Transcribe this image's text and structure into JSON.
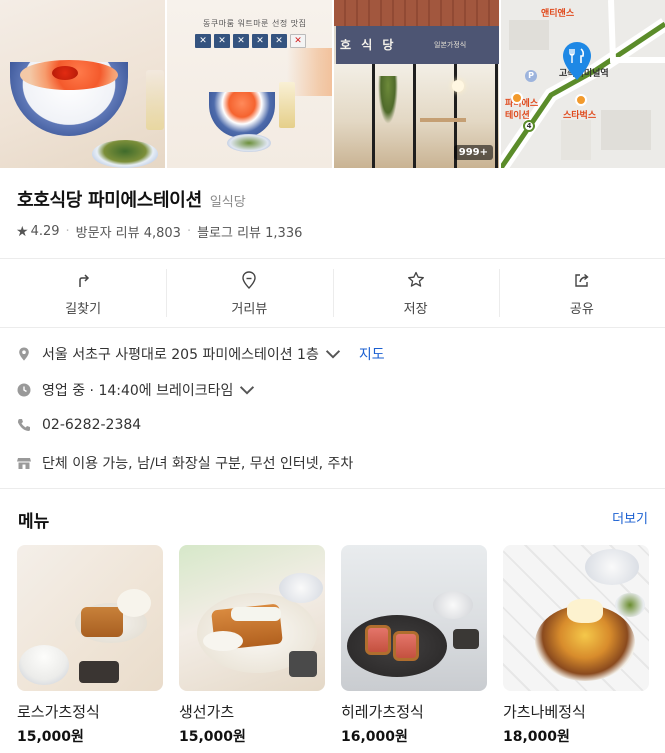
{
  "photos": {
    "poster_title": "동쿠마룸 워트마룬 선정 맛집",
    "poster_badges": [
      "✕",
      "✕",
      "✕",
      "✕",
      "✕",
      "✕"
    ],
    "store_sign": "호 식 당",
    "store_sign_sub": "일본가정식",
    "photo_count": "999+",
    "map_labels": {
      "entis": "앤티앤스",
      "terminal": "고속터미널역",
      "starbucks": "스타벅스",
      "famille": "파미에스테이션",
      "parking": "P",
      "metro": "4"
    }
  },
  "place": {
    "name": "호호식당 파미에스테이션",
    "category": "일식당",
    "rating": "4.29",
    "visitor_reviews": "방문자 리뷰 4,803",
    "blog_reviews": "블로그 리뷰 1,336"
  },
  "actions": [
    {
      "label": "길찾기",
      "icon": "directions-icon"
    },
    {
      "label": "거리뷰",
      "icon": "streetview-pin-icon"
    },
    {
      "label": "저장",
      "icon": "star-outline-icon"
    },
    {
      "label": "공유",
      "icon": "share-icon"
    }
  ],
  "info": {
    "address": "서울 서초구 사평대로 205 파미에스테이션 1층",
    "map_link": "지도",
    "hours": "영업 중 · 14:40에 브레이크타임",
    "phone": "02-6282-2384",
    "amenities": "단체 이용 가능, 남/녀 화장실 구분, 무선 인터넷, 주차"
  },
  "menu": {
    "title": "메뉴",
    "more": "더보기",
    "items": [
      {
        "name": "로스가츠정식",
        "price": "15,000원"
      },
      {
        "name": "생선가츠",
        "price": "15,000원"
      },
      {
        "name": "히레가츠정식",
        "price": "16,000원"
      },
      {
        "name": "가츠나베정식",
        "price": "18,000원"
      }
    ]
  },
  "colors": {
    "link": "#1a5fd1",
    "map_route": "#5b8c2a",
    "map_pin": "#1e88e5"
  }
}
